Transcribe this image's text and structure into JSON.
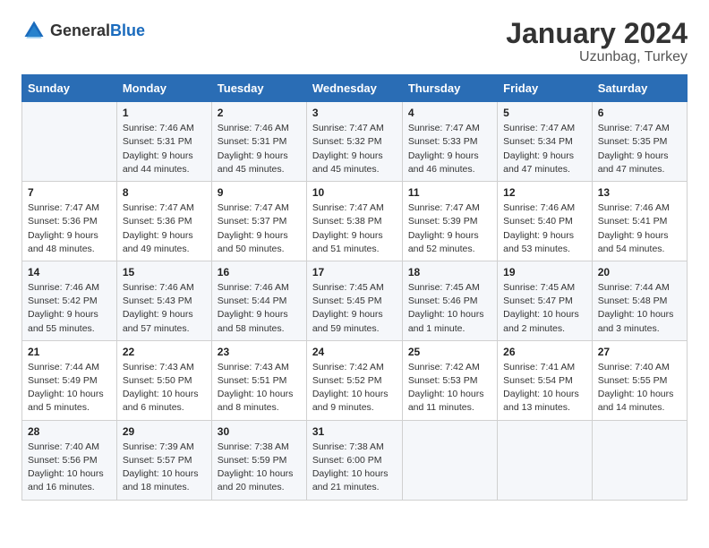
{
  "header": {
    "logo_general": "General",
    "logo_blue": "Blue",
    "title": "January 2024",
    "subtitle": "Uzunbag, Turkey"
  },
  "days_of_week": [
    "Sunday",
    "Monday",
    "Tuesday",
    "Wednesday",
    "Thursday",
    "Friday",
    "Saturday"
  ],
  "weeks": [
    [
      {
        "day": "",
        "sunrise": "",
        "sunset": "",
        "daylight": ""
      },
      {
        "day": "1",
        "sunrise": "Sunrise: 7:46 AM",
        "sunset": "Sunset: 5:31 PM",
        "daylight": "Daylight: 9 hours and 44 minutes."
      },
      {
        "day": "2",
        "sunrise": "Sunrise: 7:46 AM",
        "sunset": "Sunset: 5:31 PM",
        "daylight": "Daylight: 9 hours and 45 minutes."
      },
      {
        "day": "3",
        "sunrise": "Sunrise: 7:47 AM",
        "sunset": "Sunset: 5:32 PM",
        "daylight": "Daylight: 9 hours and 45 minutes."
      },
      {
        "day": "4",
        "sunrise": "Sunrise: 7:47 AM",
        "sunset": "Sunset: 5:33 PM",
        "daylight": "Daylight: 9 hours and 46 minutes."
      },
      {
        "day": "5",
        "sunrise": "Sunrise: 7:47 AM",
        "sunset": "Sunset: 5:34 PM",
        "daylight": "Daylight: 9 hours and 47 minutes."
      },
      {
        "day": "6",
        "sunrise": "Sunrise: 7:47 AM",
        "sunset": "Sunset: 5:35 PM",
        "daylight": "Daylight: 9 hours and 47 minutes."
      }
    ],
    [
      {
        "day": "7",
        "sunrise": "Sunrise: 7:47 AM",
        "sunset": "Sunset: 5:36 PM",
        "daylight": "Daylight: 9 hours and 48 minutes."
      },
      {
        "day": "8",
        "sunrise": "Sunrise: 7:47 AM",
        "sunset": "Sunset: 5:36 PM",
        "daylight": "Daylight: 9 hours and 49 minutes."
      },
      {
        "day": "9",
        "sunrise": "Sunrise: 7:47 AM",
        "sunset": "Sunset: 5:37 PM",
        "daylight": "Daylight: 9 hours and 50 minutes."
      },
      {
        "day": "10",
        "sunrise": "Sunrise: 7:47 AM",
        "sunset": "Sunset: 5:38 PM",
        "daylight": "Daylight: 9 hours and 51 minutes."
      },
      {
        "day": "11",
        "sunrise": "Sunrise: 7:47 AM",
        "sunset": "Sunset: 5:39 PM",
        "daylight": "Daylight: 9 hours and 52 minutes."
      },
      {
        "day": "12",
        "sunrise": "Sunrise: 7:46 AM",
        "sunset": "Sunset: 5:40 PM",
        "daylight": "Daylight: 9 hours and 53 minutes."
      },
      {
        "day": "13",
        "sunrise": "Sunrise: 7:46 AM",
        "sunset": "Sunset: 5:41 PM",
        "daylight": "Daylight: 9 hours and 54 minutes."
      }
    ],
    [
      {
        "day": "14",
        "sunrise": "Sunrise: 7:46 AM",
        "sunset": "Sunset: 5:42 PM",
        "daylight": "Daylight: 9 hours and 55 minutes."
      },
      {
        "day": "15",
        "sunrise": "Sunrise: 7:46 AM",
        "sunset": "Sunset: 5:43 PM",
        "daylight": "Daylight: 9 hours and 57 minutes."
      },
      {
        "day": "16",
        "sunrise": "Sunrise: 7:46 AM",
        "sunset": "Sunset: 5:44 PM",
        "daylight": "Daylight: 9 hours and 58 minutes."
      },
      {
        "day": "17",
        "sunrise": "Sunrise: 7:45 AM",
        "sunset": "Sunset: 5:45 PM",
        "daylight": "Daylight: 9 hours and 59 minutes."
      },
      {
        "day": "18",
        "sunrise": "Sunrise: 7:45 AM",
        "sunset": "Sunset: 5:46 PM",
        "daylight": "Daylight: 10 hours and 1 minute."
      },
      {
        "day": "19",
        "sunrise": "Sunrise: 7:45 AM",
        "sunset": "Sunset: 5:47 PM",
        "daylight": "Daylight: 10 hours and 2 minutes."
      },
      {
        "day": "20",
        "sunrise": "Sunrise: 7:44 AM",
        "sunset": "Sunset: 5:48 PM",
        "daylight": "Daylight: 10 hours and 3 minutes."
      }
    ],
    [
      {
        "day": "21",
        "sunrise": "Sunrise: 7:44 AM",
        "sunset": "Sunset: 5:49 PM",
        "daylight": "Daylight: 10 hours and 5 minutes."
      },
      {
        "day": "22",
        "sunrise": "Sunrise: 7:43 AM",
        "sunset": "Sunset: 5:50 PM",
        "daylight": "Daylight: 10 hours and 6 minutes."
      },
      {
        "day": "23",
        "sunrise": "Sunrise: 7:43 AM",
        "sunset": "Sunset: 5:51 PM",
        "daylight": "Daylight: 10 hours and 8 minutes."
      },
      {
        "day": "24",
        "sunrise": "Sunrise: 7:42 AM",
        "sunset": "Sunset: 5:52 PM",
        "daylight": "Daylight: 10 hours and 9 minutes."
      },
      {
        "day": "25",
        "sunrise": "Sunrise: 7:42 AM",
        "sunset": "Sunset: 5:53 PM",
        "daylight": "Daylight: 10 hours and 11 minutes."
      },
      {
        "day": "26",
        "sunrise": "Sunrise: 7:41 AM",
        "sunset": "Sunset: 5:54 PM",
        "daylight": "Daylight: 10 hours and 13 minutes."
      },
      {
        "day": "27",
        "sunrise": "Sunrise: 7:40 AM",
        "sunset": "Sunset: 5:55 PM",
        "daylight": "Daylight: 10 hours and 14 minutes."
      }
    ],
    [
      {
        "day": "28",
        "sunrise": "Sunrise: 7:40 AM",
        "sunset": "Sunset: 5:56 PM",
        "daylight": "Daylight: 10 hours and 16 minutes."
      },
      {
        "day": "29",
        "sunrise": "Sunrise: 7:39 AM",
        "sunset": "Sunset: 5:57 PM",
        "daylight": "Daylight: 10 hours and 18 minutes."
      },
      {
        "day": "30",
        "sunrise": "Sunrise: 7:38 AM",
        "sunset": "Sunset: 5:59 PM",
        "daylight": "Daylight: 10 hours and 20 minutes."
      },
      {
        "day": "31",
        "sunrise": "Sunrise: 7:38 AM",
        "sunset": "Sunset: 6:00 PM",
        "daylight": "Daylight: 10 hours and 21 minutes."
      },
      {
        "day": "",
        "sunrise": "",
        "sunset": "",
        "daylight": ""
      },
      {
        "day": "",
        "sunrise": "",
        "sunset": "",
        "daylight": ""
      },
      {
        "day": "",
        "sunrise": "",
        "sunset": "",
        "daylight": ""
      }
    ]
  ]
}
